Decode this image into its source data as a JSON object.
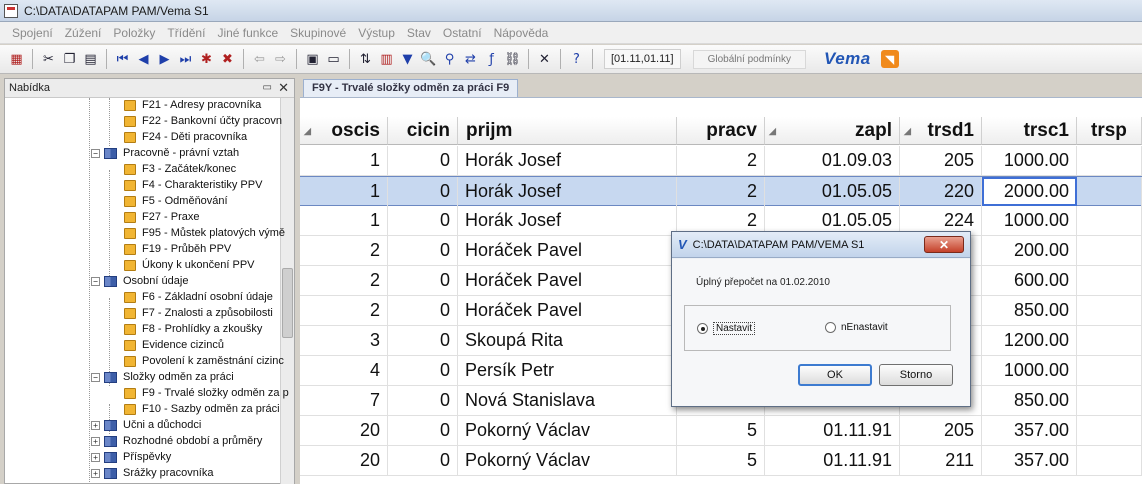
{
  "window": {
    "title": "C:\\DATA\\DATAPAM PAM/Vema S1"
  },
  "menu": [
    "Spojení",
    "Zúžení",
    "Položky",
    "Třídění",
    "Jiné funkce",
    "Skupinové",
    "Výstup",
    "Stav",
    "Ostatní",
    "Nápověda"
  ],
  "toolbar": {
    "date_range": "[01.11,01.11]",
    "global_conditions": "Globální podmínky",
    "logo": "Vema",
    "icons": [
      "grid-icon",
      "cut-icon",
      "copy-icon",
      "paste-icon",
      "first-record-icon",
      "prev-record-icon",
      "next-record-icon",
      "last-record-icon",
      "new-record-icon",
      "delete-record-icon",
      "back-icon",
      "forward-icon",
      "save-icon",
      "form-icon",
      "sort-icon",
      "filter-grid-icon",
      "filter-icon",
      "search-icon",
      "find-icon",
      "replace-icon",
      "formula-icon",
      "link-icon",
      "tools-icon",
      "help-icon",
      "rss-icon"
    ]
  },
  "sidebar": {
    "header": "Nabídka",
    "items": [
      {
        "label": "F21 - Adresy pracovníka",
        "type": "folder"
      },
      {
        "label": "F22 - Bankovní účty pracovn",
        "type": "folder"
      },
      {
        "label": "F24 - Děti pracovníka",
        "type": "folder"
      },
      {
        "label": "Pracovně - právní vztah",
        "type": "book",
        "expander": "−"
      },
      {
        "label": "F3 - Začátek/konec",
        "type": "folder"
      },
      {
        "label": "F4 - Charakteristiky PPV",
        "type": "folder"
      },
      {
        "label": "F5 - Odměňování",
        "type": "folder"
      },
      {
        "label": "F27 - Praxe",
        "type": "folder"
      },
      {
        "label": "F95 - Můstek platových výmě",
        "type": "folder"
      },
      {
        "label": "F19 - Průběh PPV",
        "type": "folder"
      },
      {
        "label": "Úkony k ukončení PPV",
        "type": "folder"
      },
      {
        "label": "Osobní údaje",
        "type": "book",
        "expander": "−"
      },
      {
        "label": "F6 - Základní osobní údaje",
        "type": "folder"
      },
      {
        "label": "F7 - Znalosti a způsobilosti",
        "type": "folder"
      },
      {
        "label": "F8 - Prohlídky a zkoušky",
        "type": "folder"
      },
      {
        "label": "Evidence cizinců",
        "type": "folder"
      },
      {
        "label": "Povolení k zaměstnání cizinc",
        "type": "folder"
      },
      {
        "label": "Složky odměn za práci",
        "type": "book",
        "expander": "−"
      },
      {
        "label": "F9 - Trvalé složky odměn za p",
        "type": "folder"
      },
      {
        "label": "F10 - Sazby odměn za práci",
        "type": "folder"
      },
      {
        "label": "Učni a důchodci",
        "type": "book",
        "expander": "+"
      },
      {
        "label": "Rozhodné období a průměry",
        "type": "book",
        "expander": "+"
      },
      {
        "label": "Příspěvky",
        "type": "book",
        "expander": "+"
      },
      {
        "label": "Srážky pracovníka",
        "type": "book",
        "expander": "+"
      }
    ]
  },
  "tab": {
    "label": "F9Y - Trvalé složky odměn za práci F9"
  },
  "grid": {
    "columns": [
      "oscis",
      "cicin",
      "prijm",
      "pracv",
      "zapl",
      "trsd1",
      "trsc1",
      "trsp"
    ],
    "rows": [
      [
        "1",
        "0",
        "Horák Josef",
        "2",
        "01.09.03",
        "205",
        "1000.00",
        ""
      ],
      [
        "1",
        "0",
        "Horák Josef",
        "2",
        "01.05.05",
        "220",
        "2000.00",
        ""
      ],
      [
        "1",
        "0",
        "Horák Josef",
        "2",
        "01.05.05",
        "224",
        "1000.00",
        ""
      ],
      [
        "2",
        "0",
        "Horáček Pavel",
        "",
        "",
        "",
        "200.00",
        ""
      ],
      [
        "2",
        "0",
        "Horáček Pavel",
        "",
        "",
        "",
        "600.00",
        ""
      ],
      [
        "2",
        "0",
        "Horáček Pavel",
        "",
        "",
        "",
        "850.00",
        ""
      ],
      [
        "3",
        "0",
        "Skoupá Rita",
        "",
        "",
        "",
        "1200.00",
        ""
      ],
      [
        "4",
        "0",
        "Persík Petr",
        "",
        "",
        "",
        "1000.00",
        ""
      ],
      [
        "7",
        "0",
        "Nová Stanislava",
        "",
        "",
        "",
        "850.00",
        ""
      ],
      [
        "20",
        "0",
        "Pokorný Václav",
        "5",
        "01.11.91",
        "205",
        "357.00",
        ""
      ],
      [
        "20",
        "0",
        "Pokorný Václav",
        "5",
        "01.11.91",
        "211",
        "357.00",
        ""
      ]
    ],
    "selected_row": 1
  },
  "dialog": {
    "title": "C:\\DATA\\DATAPAM PAM/VEMA S1",
    "close_label": "✕",
    "message": "Úplný přepočet na 01.02.2010",
    "option_set": "Nastavit",
    "option_unset": "nEnastavit",
    "ok_label": "OK",
    "cancel_label": "Storno"
  }
}
